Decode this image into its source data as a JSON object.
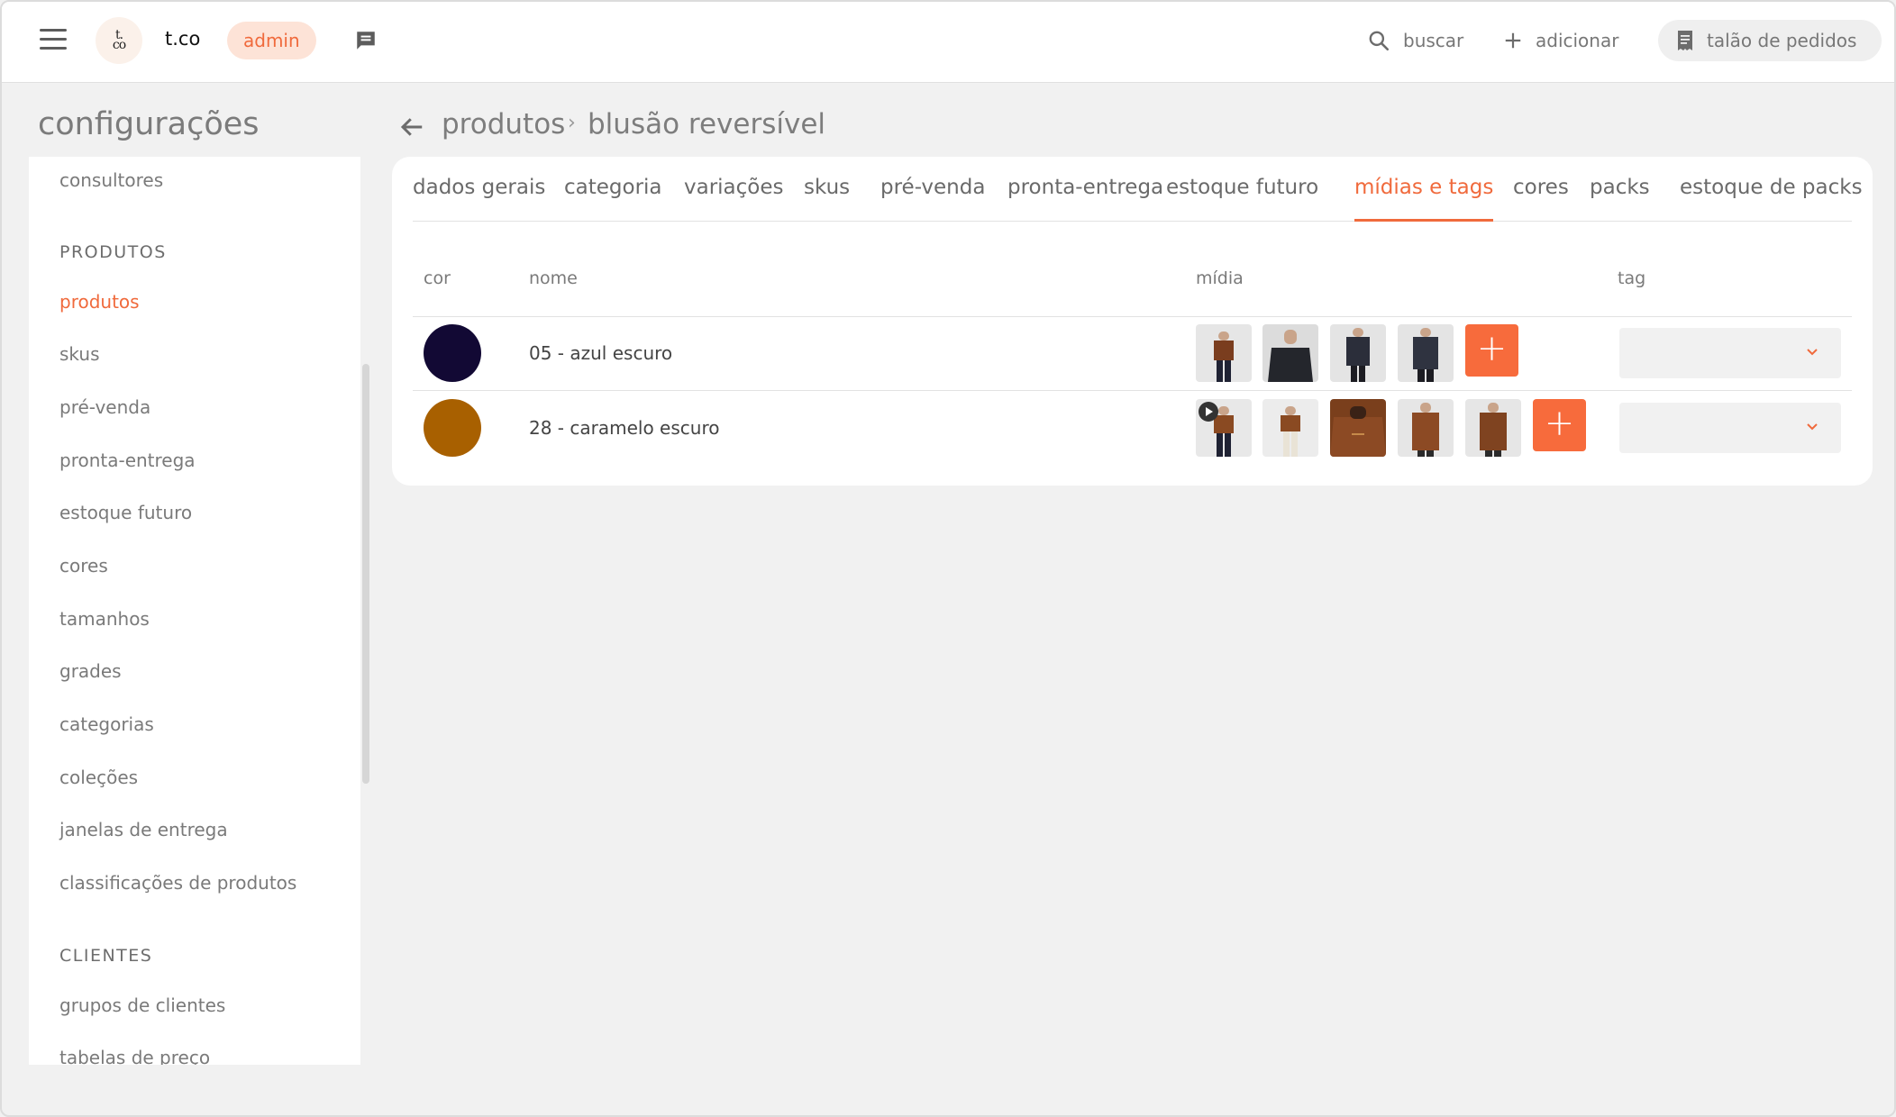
{
  "topbar": {
    "logo_line1": "t.",
    "logo_line2": "co",
    "brand": "t.co",
    "role_badge": "admin",
    "search_label": "buscar",
    "add_label": "adicionar",
    "orders_label": "talão de pedidos",
    "icons": [
      "menu-icon",
      "chat-icon",
      "search-icon",
      "plus-icon",
      "receipt-icon"
    ]
  },
  "sidebar": {
    "title": "configurações",
    "top_item": "consultores",
    "sections": [
      {
        "heading": "PRODUTOS",
        "items": [
          "produtos",
          "skus",
          "pré-venda",
          "pronta-entrega",
          "estoque futuro",
          "cores",
          "tamanhos",
          "grades",
          "categorias",
          "coleções",
          "janelas de entrega",
          "classificações de produtos"
        ]
      },
      {
        "heading": "CLIENTES",
        "items": [
          "grupos de clientes",
          "tabelas de preço"
        ]
      }
    ],
    "active_item": "produtos"
  },
  "breadcrumb": {
    "parent": "produtos",
    "separator": "›",
    "current": "blusão reversível"
  },
  "tabs": [
    "dados gerais",
    "categoria",
    "variações",
    "skus",
    "pré-venda",
    "pronta-entrega",
    "estoque futuro",
    "mídias e tags",
    "cores",
    "packs",
    "estoque de packs"
  ],
  "active_tab": "mídias e tags",
  "table": {
    "columns": [
      "cor",
      "nome",
      "mídia",
      "tag"
    ],
    "rows": [
      {
        "color": "#120934",
        "name": "05 - azul escuro",
        "media_count": 4,
        "has_video": false,
        "tag_value": ""
      },
      {
        "color": "#a86000",
        "name": "28 - caramelo escuro",
        "media_count": 5,
        "has_video": true,
        "tag_value": ""
      }
    ],
    "add_media_label": "+"
  },
  "colors": {
    "accent": "#f06a3c",
    "add_button": "#f76b3c",
    "background": "#f1f1f1"
  }
}
